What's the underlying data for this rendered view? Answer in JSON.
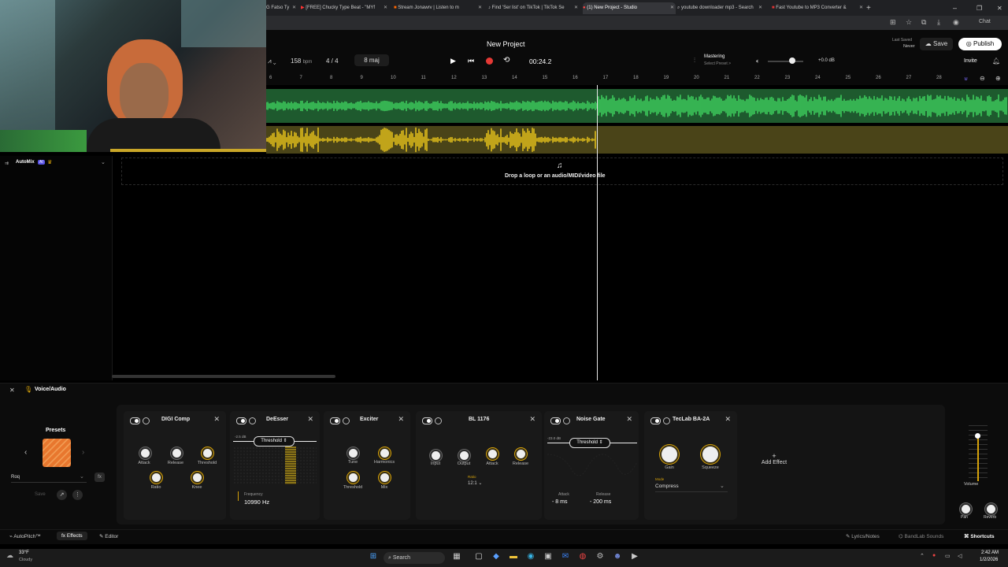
{
  "browser": {
    "tabs": [
      {
        "label": "G Fatso Ty",
        "active": false
      },
      {
        "label": "[FREE] Chucky Type Beat - \"MYf",
        "active": false
      },
      {
        "label": "Stream Jonawrv | Listen to m",
        "active": false
      },
      {
        "label": "Find 'Ser list' on TikTok | TikTok Se",
        "active": false
      },
      {
        "label": "(1) New Project - Studio",
        "active": true
      },
      {
        "label": "youtube downloader mp3 - Search",
        "active": false
      },
      {
        "label": "Fast Youtube to MP3 Converter &",
        "active": false
      }
    ],
    "profile_label": "Chat"
  },
  "header": {
    "project_title": "New Project",
    "bpm_value": "158",
    "bpm_unit": "bpm",
    "time_signature": "4 / 4",
    "key": "8 maj",
    "time_display": "00:24.2",
    "mastering_label": "Mastering",
    "mastering_preset": "Select Preset >",
    "volume_db": "+0.0 dB",
    "last_saved_label": "Last Saved",
    "last_saved_value": "Never",
    "save_label": "Save",
    "publish_label": "Publish",
    "invite_label": "Invite"
  },
  "ruler": {
    "ticks": [
      "6",
      "7",
      "8",
      "9",
      "10",
      "11",
      "12",
      "13",
      "14",
      "15",
      "16",
      "17",
      "18",
      "19",
      "20",
      "21",
      "22",
      "23",
      "24",
      "25",
      "26",
      "27",
      "28"
    ]
  },
  "track_panel": {
    "automix_label": "AutoMix",
    "ai_badge": "AI",
    "drop_text": "Drop a loop or an audio/MIDI/video file"
  },
  "fx_panel": {
    "track_name": "Voice/Audio",
    "presets_label": "Presets",
    "preset_name": "Roq",
    "save_label": "Save",
    "add_effect_label": "Add Effect",
    "volume_label": "Volume",
    "pan_label": "Pan",
    "reverb_label": "Reverb",
    "effects": {
      "digicomp": {
        "title": "DIGI Comp",
        "knobs": [
          "Attack",
          "Release",
          "Threshold",
          "Ratio",
          "Knee"
        ]
      },
      "deesser": {
        "title": "DeEsser",
        "threshold_label": "Threshold",
        "db_label": "-2.5 dB",
        "frequency_label": "Frequency",
        "frequency_value": "10990 Hz"
      },
      "exciter": {
        "title": "Exciter",
        "knobs": [
          "Tune",
          "Harmonics",
          "Threshold",
          "Mix"
        ]
      },
      "bl1176": {
        "title": "BL 1176",
        "knobs": [
          "Input",
          "Output",
          "Attack",
          "Release"
        ],
        "ratio_label": "Ratio",
        "ratio_value": "12:1"
      },
      "noisegate": {
        "title": "Noise Gate",
        "threshold_label": "Threshold",
        "db_label": "-23.0 dB",
        "attack_label": "Attack",
        "attack_value": "8 ms",
        "release_label": "Release",
        "release_value": "200 ms"
      },
      "teclab": {
        "title": "TecLab BA-2A",
        "knobs": [
          "Gain",
          "Squeeze"
        ],
        "mode_label": "Mode",
        "mode_value": "Compress"
      }
    }
  },
  "bottom_bar": {
    "autopitch_label": "AutoPitch™",
    "effects_label": "Effects",
    "editor_label": "Editor",
    "lyrics_label": "Lyrics/Notes",
    "sounds_label": "BandLab Sounds",
    "shortcuts_label": "Shortcuts"
  },
  "taskbar": {
    "weather_temp": "33°F",
    "weather_desc": "Cloudy",
    "search_label": "Search",
    "time": "2:42 AM",
    "date": "1/2/2026"
  },
  "colors": {
    "green_wave": "#3fd15f",
    "yellow_wave": "#e9c51a",
    "accent_yellow": "#d6a20a",
    "preset_orange": "#e8772e"
  }
}
